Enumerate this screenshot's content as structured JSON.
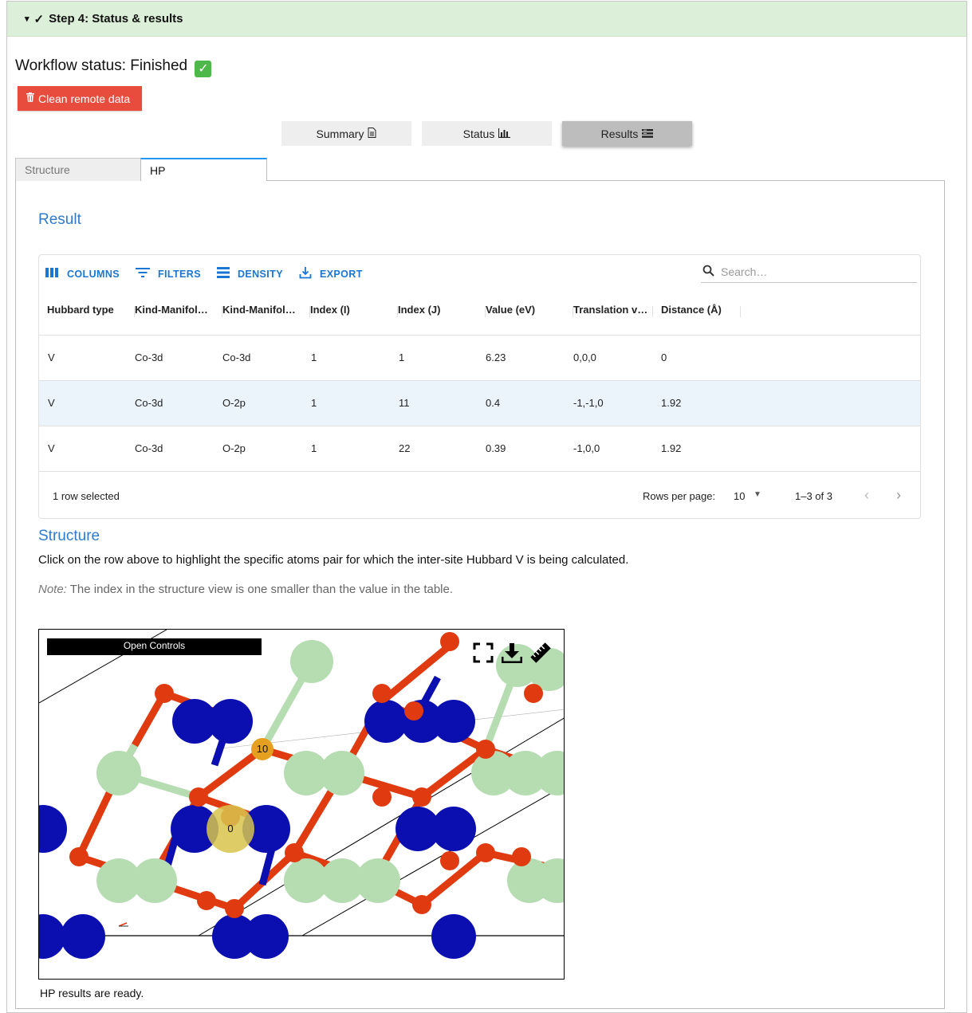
{
  "header": {
    "caret": "▾",
    "check": "✓",
    "title": "Step 4: Status & results"
  },
  "workflow": {
    "status_text": "Workflow status: Finished",
    "status_icon": "✓"
  },
  "clean_button": {
    "label": "Clean remote data",
    "color": "#e74c3c"
  },
  "toggles": [
    {
      "label": "Summary",
      "active": false
    },
    {
      "label": "Status",
      "active": false
    },
    {
      "label": "Results",
      "active": true
    }
  ],
  "tabs": [
    {
      "label": "Structure",
      "active": false
    },
    {
      "label": "HP",
      "active": true
    }
  ],
  "result": {
    "heading": "Result",
    "toolbar": {
      "columns": "COLUMNS",
      "filters": "FILTERS",
      "density": "DENSITY",
      "export": "EXPORT"
    },
    "search_placeholder": "Search…",
    "columns": [
      "Hubbard type",
      "Kind-Manifol…",
      "Kind-Manifol…",
      "Index (I)",
      "Index (J)",
      "Value (eV)",
      "Translation v…",
      "Distance (Å)"
    ],
    "rows": [
      {
        "cells": [
          "V",
          "Co-3d",
          "Co-3d",
          "1",
          "1",
          "6.23",
          "0,0,0",
          "0"
        ],
        "selected": false
      },
      {
        "cells": [
          "V",
          "Co-3d",
          "O-2p",
          "1",
          "11",
          "0.4",
          "-1,-1,0",
          "1.92"
        ],
        "selected": true
      },
      {
        "cells": [
          "V",
          "Co-3d",
          "O-2p",
          "1",
          "22",
          "0.39",
          "-1,0,0",
          "1.92"
        ],
        "selected": false
      }
    ],
    "footer": {
      "selected_text": "1 row selected",
      "rows_per_page_label": "Rows per page:",
      "rows_per_page_value": "10",
      "range": "1–3 of 3"
    }
  },
  "structure": {
    "heading": "Structure",
    "instruction": "Click on the row above to highlight the specific atoms pair for which the inter-site Hubbard V is being calculated.",
    "note_label": "Note:",
    "note_text": " The index in the structure view is one smaller than the value in the table.",
    "viewer": {
      "open_controls": "Open Controls",
      "labels": {
        "atom_a": "0",
        "atom_b": "10"
      },
      "icons": [
        "fullscreen-icon",
        "download-icon",
        "ruler-icon"
      ],
      "colors": {
        "cobalt": "#0b0fb0",
        "oxygen": "#e03a10",
        "lithium": "#b6dcb2",
        "highlight": "#d8c44c"
      }
    },
    "ready_text": "HP results are ready."
  }
}
